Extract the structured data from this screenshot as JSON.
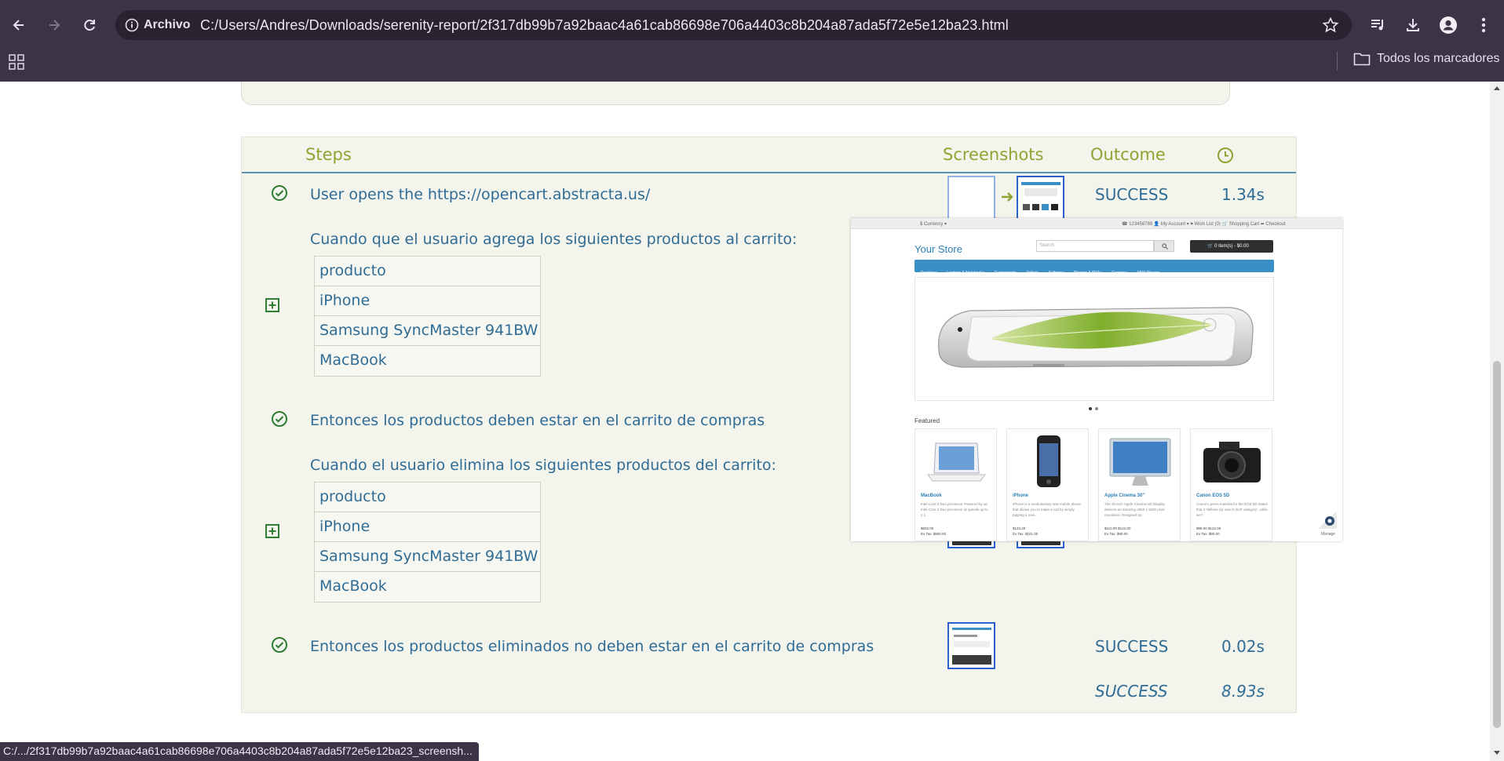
{
  "browser": {
    "site_info_label": "Archivo",
    "url": "C:/Users/Andres/Downloads/serenity-report/2f317db99b7a92baac4a61cab86698e706a4403c8b204a87ada5f72e5e12ba23.html",
    "bookmarks_folder": "Todos los marcadores"
  },
  "report": {
    "columns": {
      "steps": "Steps",
      "screenshots": "Screenshots",
      "outcome": "Outcome"
    },
    "steps": [
      {
        "text": "User opens the https://opencart.abstracta.us/",
        "outcome": "SUCCESS",
        "duration": "1.34s"
      },
      {
        "text": "Cuando que el usuario agrega los siguientes productos al carrito:",
        "table": [
          "producto",
          "iPhone",
          "Samsung SyncMaster 941BW",
          "MacBook"
        ]
      },
      {
        "text": "Entonces los productos deben estar en el carrito de compras"
      },
      {
        "text": "Cuando el usuario elimina los siguientes productos del carrito:",
        "table": [
          "producto",
          "iPhone",
          "Samsung SyncMaster 941BW",
          "MacBook"
        ]
      },
      {
        "text": "Entonces los productos eliminados no deben estar en el carrito de compras",
        "outcome": "SUCCESS",
        "duration": "0.02s"
      }
    ],
    "total": {
      "outcome": "SUCCESS",
      "duration": "8.93s"
    }
  },
  "screenshot_preview": {
    "currency": "$ Currency ▾",
    "top_links": "☎ 123456789   👤 My Account ▾   ♥ Wish List (0)   🛒 Shopping Cart   ➦ Checkout",
    "store_name": "Your Store",
    "search_placeholder": "Search",
    "cart_button": "🛒 0 item(s) - $0.00",
    "menu": [
      "Desktops",
      "Laptops & Notebooks",
      "Components",
      "Tablets",
      "Software",
      "Phones & PDAs",
      "Cameras",
      "MP3 Players"
    ],
    "featured_label": "Featured",
    "products": [
      {
        "name": "MacBook",
        "desc": "Intel Core 2 Duo processor Powered by an Intel Core 2 Duo processor at speeds up to 2.1..",
        "price": "$602.00",
        "tax": "Ex Tax: $500.00"
      },
      {
        "name": "iPhone",
        "desc": "iPhone is a revolutionary new mobile phone that allows you to make a call by simply tapping a nam..",
        "price": "$123.20",
        "tax": "Ex Tax: $101.00"
      },
      {
        "name": "Apple Cinema 30\"",
        "desc": "The 30-inch Apple Cinema HD Display delivers an amazing 2560 x 1600 pixel resolution. Designed sp..",
        "price": "$110.00  $122.00",
        "tax": "Ex Tax: $90.00"
      },
      {
        "name": "Canon EOS 5D",
        "desc": "Canon's press material for the EOS 5D states that it 'defines (a) new D-SLR category', while we'r..",
        "price": "$98.00  $122.00",
        "tax": "Ex Tax: $80.00"
      }
    ],
    "manage_label": "Manage"
  },
  "status_bar": "C:/.../2f317db99b7a92baac4a61cab86698e706a4403c8b204a87ada5f72e5e12ba23_screensh...",
  "colors": {
    "chrome": "#3c3347",
    "panel": "#f3f4ec",
    "heading": "#8ea532",
    "text": "#2f6c96",
    "thumb_border": "#2b5fd0"
  }
}
